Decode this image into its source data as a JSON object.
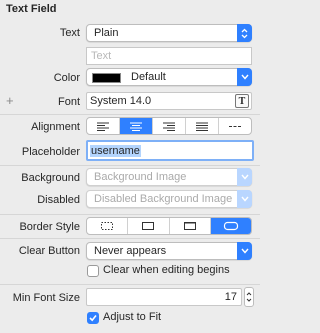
{
  "section_title": "Text Field",
  "text": {
    "label": "Text",
    "style_value": "Plain",
    "value_placeholder": "Text"
  },
  "color": {
    "label": "Color",
    "value": "Default",
    "swatch": "#000000"
  },
  "font": {
    "label": "Font",
    "value": "System 14.0",
    "add_icon": "+"
  },
  "alignment": {
    "label": "Alignment",
    "options": [
      "left",
      "center",
      "right",
      "justified",
      "natural"
    ],
    "selected": "center"
  },
  "placeholder": {
    "label": "Placeholder",
    "value": "username"
  },
  "background": {
    "label": "Background",
    "placeholder": "Background Image"
  },
  "disabled": {
    "label": "Disabled",
    "placeholder": "Disabled Background Image"
  },
  "border_style": {
    "label": "Border Style",
    "options": [
      "none",
      "line",
      "bezel",
      "rounded"
    ],
    "selected": "rounded"
  },
  "clear_button": {
    "label": "Clear Button",
    "value": "Never appears",
    "checkbox_label": "Clear when editing begins",
    "checkbox_checked": false
  },
  "min_font_size": {
    "label": "Min Font Size",
    "value": "17"
  },
  "adjust_to_fit": {
    "label": "Adjust to Fit",
    "checked": true
  },
  "colors": {
    "accent": "#2f80ff",
    "panel": "#ececec"
  }
}
